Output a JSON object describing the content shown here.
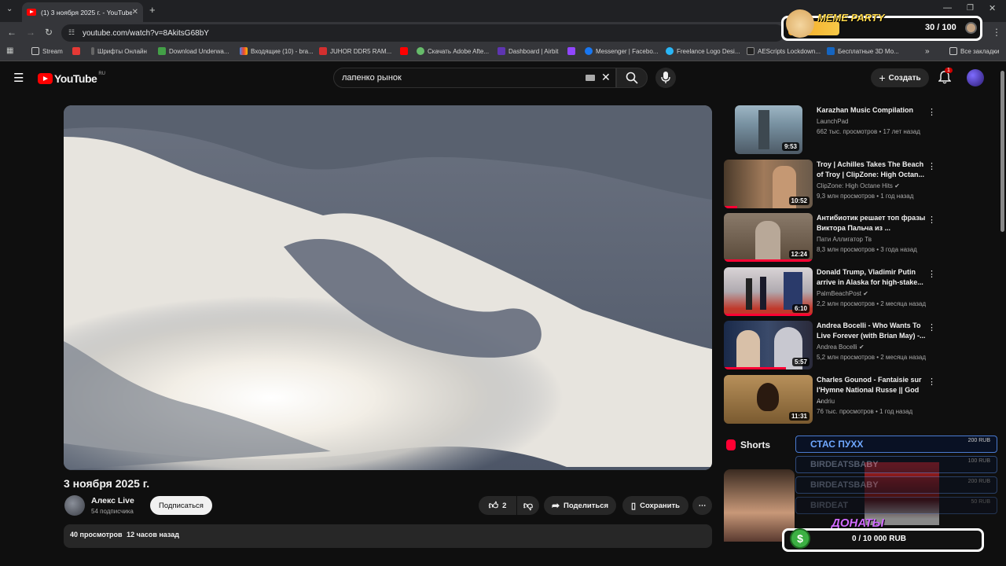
{
  "browser": {
    "tab_title": "(1) 3 ноября 2025 г. - YouTube",
    "url": "youtube.com/watch?v=8AkitsG68bY",
    "bookmarks": [
      "Stream",
      "Шрифты Онлайн",
      "Download Underwa...",
      "Входящие (10) - bra...",
      "JUHOR DDR5 RAM...",
      "Скачать Adobe Afte...",
      "Dashboard | Airbit",
      "Messenger | Facebo...",
      "Freelance Logo Desi...",
      "AEScripts Lockdown...",
      "Бесплатные 3D Mo..."
    ],
    "all_bookmarks": "Все закладки"
  },
  "youtube": {
    "logo": "YouTube",
    "region": "RU",
    "search_value": "лапенко рынок",
    "create_label": "Создать",
    "notif_count": "1"
  },
  "video": {
    "title": "3 ноября 2025 г.",
    "channel": "Алекс Live",
    "subscribers": "54 подписчика",
    "subscribe_label": "Подписаться",
    "likes": "2",
    "share_label": "Поделиться",
    "save_label": "Сохранить",
    "views": "40 просмотров",
    "age": "12 часов назад"
  },
  "recommendations": [
    {
      "title": "Karazhan Music Compilation",
      "channel": "LaunchPad",
      "meta": "662 тыс. просмотров • 17 лет назад",
      "duration": "9:53",
      "progress": 0
    },
    {
      "title": "Troy | Achilles Takes The Beach of Troy | ClipZone: High Octan...",
      "channel": "ClipZone: High Octane Hits",
      "meta": "9,3 млн просмотров • 1 год назад",
      "duration": "10:52",
      "progress": 0.15
    },
    {
      "title": "Антибиотик решает топ фразы Виктора Пальча из ...",
      "channel": "Пати Аллигатор Тв",
      "meta": "8,3 млн просмотров • 3 года назад",
      "duration": "12:24",
      "progress": 1
    },
    {
      "title": "Donald Trump, Vladimir Putin arrive in Alaska for high-stake...",
      "channel": "PalmBeachPost",
      "meta": "2,2 млн просмотров • 2 месяца назад",
      "duration": "6:10",
      "progress": 1
    },
    {
      "title": "Andrea Bocelli - Who Wants To Live Forever (with Brian May) -...",
      "channel": "Andrea Bocelli",
      "meta": "5,2 млн просмотров • 2 месяца назад",
      "duration": "5:57",
      "progress": 0.7
    },
    {
      "title": "Charles Gounod - Fantaisie sur l'Hymne National Russe || God ...",
      "channel": "Andriu",
      "meta": "76 тыс. просмотров • 1 год назад",
      "duration": "11:31",
      "progress": 0
    }
  ],
  "shorts_label": "Shorts",
  "overlay": {
    "meme_title": "MEME PARTY",
    "meme_count": "30 / 100",
    "meme_fill": 0.3,
    "donations": [
      {
        "name": "СТАС ПУХХ",
        "amount": "200 RUB"
      },
      {
        "name": "BIRDEATSBABY",
        "amount": "100 RUB"
      },
      {
        "name": "BIRDEATSBABY",
        "amount": "200 RUB"
      },
      {
        "name": "BIRDEAT",
        "amount": "50 RUB"
      }
    ],
    "donate_title": "ДОНАТЫ",
    "donate_progress": "0 / 10 000 RUB"
  }
}
